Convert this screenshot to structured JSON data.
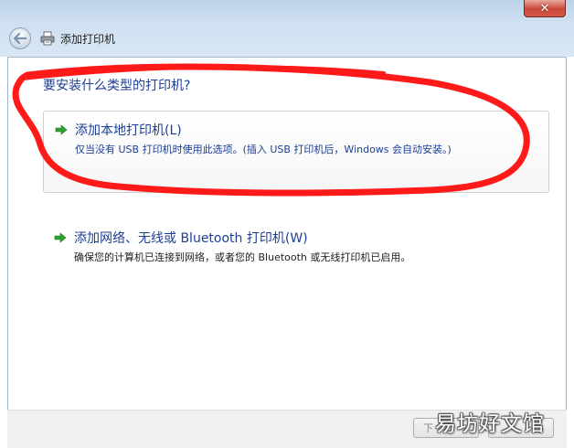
{
  "window": {
    "title": "添加打印机",
    "close_label": "✕"
  },
  "main": {
    "heading": "要安装什么类型的打印机?",
    "options": [
      {
        "title": "添加本地打印机(L)",
        "description": "仅当没有 USB 打印机时使用此选项。(插入 USB 打印机后，Windows 会自动安装。)"
      },
      {
        "title": "添加网络、无线或 Bluetooth 打印机(W)",
        "description": "确保您的计算机已连接到网络，或者您的 Bluetooth 或无线打印机已启用。"
      }
    ]
  },
  "footer": {
    "next_label": "下"
  },
  "watermark": "易坊好文馆",
  "colors": {
    "link_blue": "#1c3f94",
    "annotation_red": "#ff1a1a",
    "arrow_green": "#2ea12e"
  }
}
